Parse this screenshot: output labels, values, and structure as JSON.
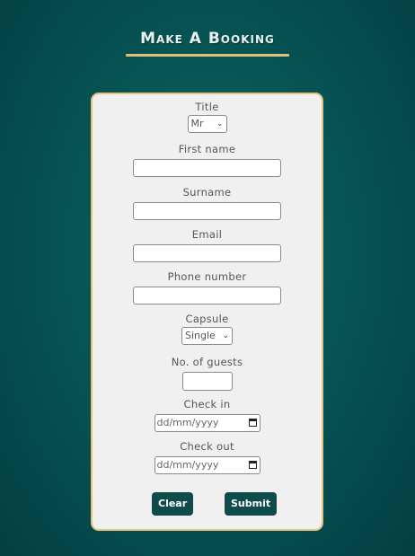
{
  "page": {
    "title": "Make A Booking"
  },
  "form": {
    "title": {
      "label": "Title",
      "value": "Mr"
    },
    "first_name": {
      "label": "First name",
      "value": ""
    },
    "surname": {
      "label": "Surname",
      "value": ""
    },
    "email": {
      "label": "Email",
      "value": ""
    },
    "phone": {
      "label": "Phone number",
      "value": ""
    },
    "capsule": {
      "label": "Capsule",
      "value": "Single"
    },
    "guests": {
      "label": "No. of guests",
      "value": ""
    },
    "check_in": {
      "label": "Check in",
      "placeholder": "dd/mm/yyyy"
    },
    "check_out": {
      "label": "Check out",
      "placeholder": "dd/mm/yyyy"
    },
    "buttons": {
      "clear": "Clear",
      "submit": "Submit"
    }
  },
  "colors": {
    "accent": "#e6c27e",
    "button": "#0e4b4b",
    "background": "#075555"
  }
}
